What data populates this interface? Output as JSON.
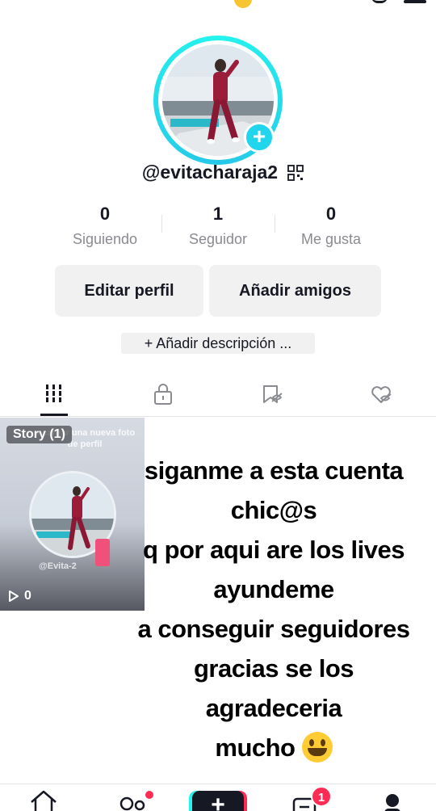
{
  "profile": {
    "username": "@evitacharaja2",
    "stats": [
      {
        "value": "0",
        "label": "Siguiendo"
      },
      {
        "value": "1",
        "label": "Seguidor"
      },
      {
        "value": "0",
        "label": "Me gusta"
      }
    ],
    "edit_button": "Editar perfil",
    "add_friends_button": "Añadir amigos",
    "add_description": "+ Añadir descripción ..."
  },
  "tabs": [
    {
      "icon": "grid-icon",
      "active": true
    },
    {
      "icon": "lock-icon",
      "active": false
    },
    {
      "icon": "bookmark-icon",
      "active": false
    },
    {
      "icon": "liked-heart-icon",
      "active": false
    }
  ],
  "video": {
    "badge": "Story (1)",
    "overlay_text": "a cargar una nueva foto de perfil",
    "watermark": "@Evita-2",
    "play_count": "0"
  },
  "caption": [
    "siganme a esta cuenta",
    "chic@s",
    "q por aqui are los lives",
    "ayundeme",
    "a conseguir seguidores",
    "gracias se los",
    "agradeceria",
    "mucho"
  ],
  "bottom_nav": {
    "items": [
      "home-icon",
      "friends-icon",
      "create-icon",
      "inbox-icon",
      "profile-icon"
    ],
    "inbox_badge": "1",
    "create_label": "+"
  },
  "colors": {
    "accent_cyan": "#20d5ec",
    "accent_red": "#fe2c55",
    "text_primary": "#161823",
    "text_secondary": "#8a8b91",
    "button_bg": "#f1f1f2"
  }
}
